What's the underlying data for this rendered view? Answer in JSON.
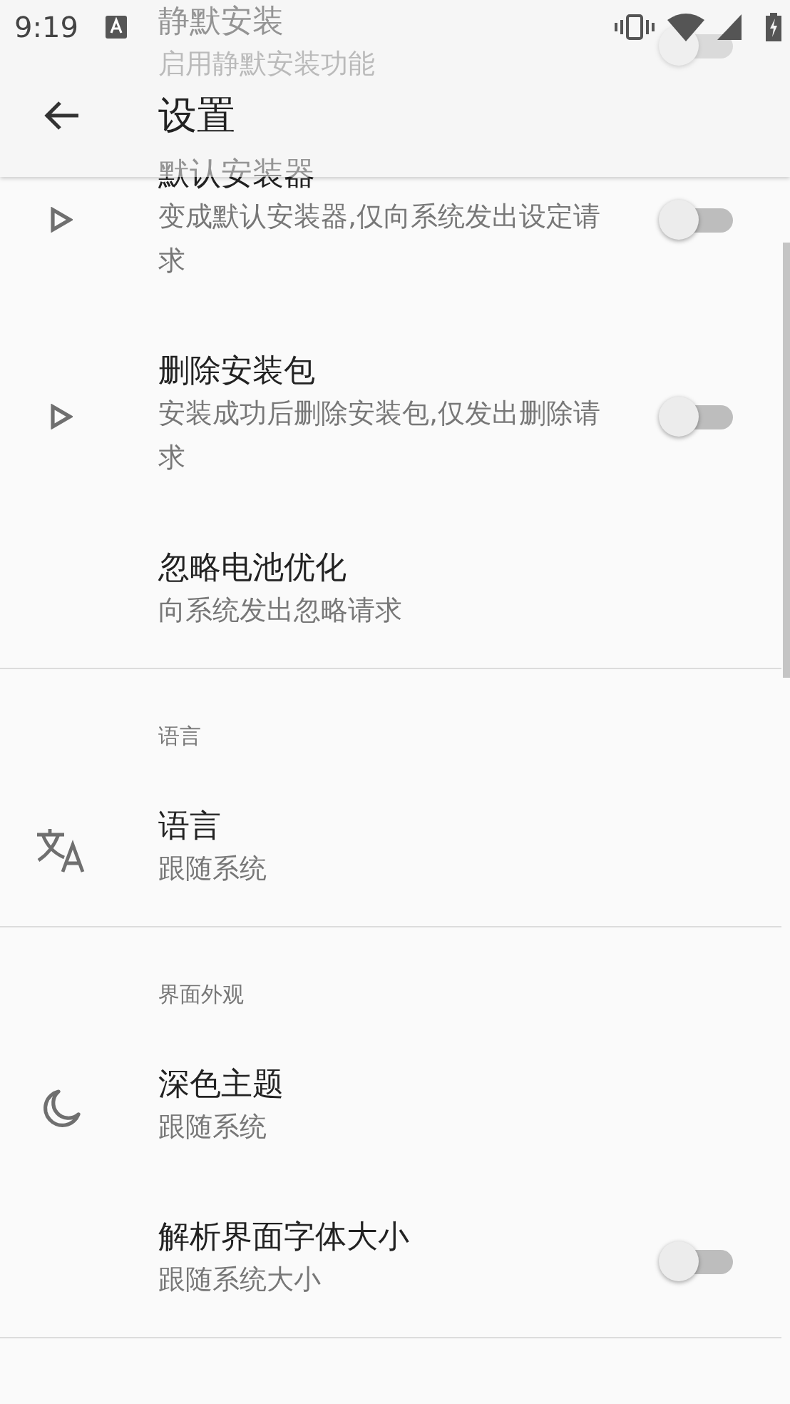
{
  "status_bar": {
    "time": "9:19"
  },
  "app_bar": {
    "title": "设置"
  },
  "sections": [
    {
      "items": [
        {
          "title": "静默安装",
          "summary": "启用静默安装功能",
          "kind": "switch",
          "on": false
        },
        {
          "title": "默认安装器",
          "summary": "变成默认安装器,仅向系统发出设定请求",
          "kind": "switch",
          "on": false
        },
        {
          "title": "删除安装包",
          "summary": "安装成功后删除安装包,仅发出删除请求",
          "kind": "switch",
          "on": false
        },
        {
          "title": "忽略电池优化",
          "summary": "向系统发出忽略请求",
          "kind": "plain"
        }
      ]
    },
    {
      "category": "语言",
      "items": [
        {
          "title": "语言",
          "summary": "跟随系统",
          "kind": "plain"
        }
      ]
    },
    {
      "category": "界面外观",
      "items": [
        {
          "title": "深色主题",
          "summary": "跟随系统",
          "kind": "plain"
        },
        {
          "title": "解析界面字体大小",
          "summary": "跟随系统大小",
          "kind": "switch",
          "on": false
        }
      ]
    }
  ]
}
